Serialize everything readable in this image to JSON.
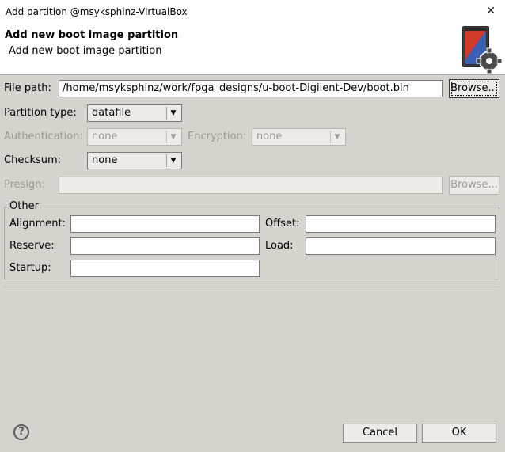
{
  "window": {
    "title": "Add partition @msyksphinz-VirtualBox",
    "close_glyph": "✕"
  },
  "banner": {
    "heading": "Add new boot image partition",
    "subheading": "Add new boot image partition",
    "icon": "boot-image-gear-icon"
  },
  "file_path": {
    "label": "File path:",
    "value": "/home/msyksphinz/work/fpga_designs/u-boot-Digilent-Dev/boot.bin",
    "browse_label": "Browse..."
  },
  "partition_type": {
    "label": "Partition type:",
    "value": "datafile"
  },
  "authentication": {
    "label": "Authentication:",
    "value": "none"
  },
  "encryption": {
    "label": "Encryption:",
    "value": "none"
  },
  "checksum": {
    "label": "Checksum:",
    "value": "none"
  },
  "presign": {
    "label": "Presign:",
    "value": "",
    "browse_label": "Browse..."
  },
  "other": {
    "title": "Other",
    "alignment_label": "Alignment:",
    "alignment_value": "",
    "offset_label": "Offset:",
    "offset_value": "",
    "reserve_label": "Reserve:",
    "reserve_value": "",
    "load_label": "Load:",
    "load_value": "",
    "startup_label": "Startup:",
    "startup_value": ""
  },
  "footer": {
    "help_glyph": "?",
    "cancel_label": "Cancel",
    "ok_label": "OK"
  },
  "glyphs": {
    "dropdown": "▼"
  }
}
